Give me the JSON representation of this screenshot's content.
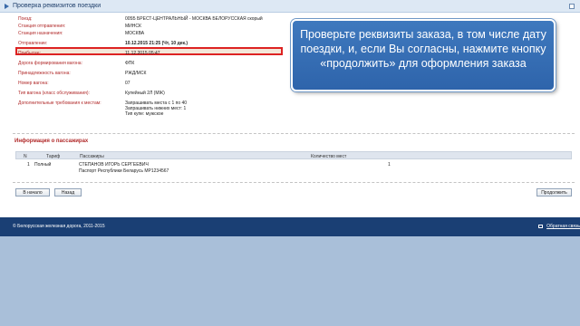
{
  "title": "Проверка реквизитов поездки",
  "details": [
    {
      "label": "Поезд:",
      "value": "005Б БРЕСТ-ЦЕНТРАЛЬНЫЙ - МОСКВА БЕЛОРУССКАЯ скорый"
    },
    {
      "label": "Станция отправления:",
      "value": "МИНСК"
    },
    {
      "label": "Станция назначения:",
      "value": "МОСКВА"
    },
    {
      "label": "Отправление:",
      "value": "10.12.2015 21:25 (Чт, 10 дек.)"
    },
    {
      "label": "Прибытие:",
      "value": "11.12.2015 05:47"
    },
    {
      "label": "Дорога формирования вагона:",
      "value": "ФПК"
    },
    {
      "label": "Принадлежность вагона:",
      "value": "РЖД/МСК"
    },
    {
      "label": "Номер вагона:",
      "value": "07"
    },
    {
      "label": "Тип вагона (класс обслуживания):",
      "value": "Купейный 2Л (МЖ)"
    },
    {
      "label": "Дополнительные требования к местам:",
      "value_lines": [
        "Запрашивать места с 1 по 40",
        "Запрашивать нижних мест: 1",
        "Тип купе: мужское"
      ]
    }
  ],
  "tooltip": {
    "text": "Проверьте реквизиты заказа, в том числе дату поездки, и, если Вы согласны, нажмите кнопку «продолжить» для оформления заказа"
  },
  "passengers": {
    "section_title": "Информация о пассажирах",
    "headers": {
      "n": "N",
      "tariff": "Тариф",
      "passengers": "Пассажиры",
      "seats": "Количество мест"
    },
    "rows": [
      {
        "n": "1",
        "tariff": "Полный",
        "name": "СТЕПАНОВ ИГОРЬ СЕРГЕЕВИЧ",
        "doc": "Паспорт Республики Беларусь МР1234567",
        "seats": "1"
      }
    ]
  },
  "buttons": {
    "start": "В начало",
    "back": "Назад",
    "continue": "Продолжить"
  },
  "footer": {
    "copyright": "© Белорусская железная дорога, 2011-2015",
    "feedback": "Обратная связь"
  }
}
